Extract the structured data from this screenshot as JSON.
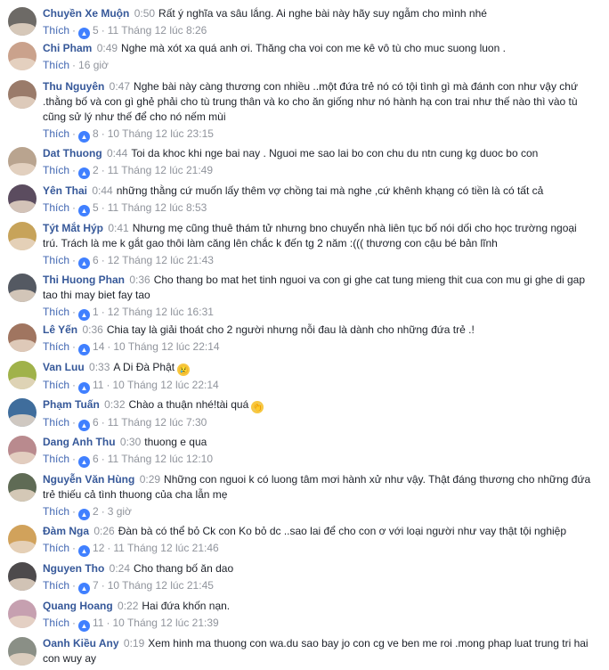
{
  "comments": [
    {
      "author": "Chuyền Xe Muộn",
      "ts": "0:50",
      "text": "Rất ý nghĩa va sâu lắng. Ai nghe bài này hãy suy ngẫm cho mình nhé",
      "like": "Thích",
      "likes": "5",
      "time": "11 Tháng 12 lúc 8:26",
      "avatar": "#6d6a66"
    },
    {
      "author": "Chi Pham",
      "ts": "0:49",
      "text": "Nghe mà xót xa quá anh ơi. Thăng cha voi con me kê vô tù cho muc suong luon .",
      "like": "Thích",
      "likes": "",
      "time": "16 giờ",
      "avatar": "#caa28c"
    },
    {
      "author": "Thu Nguyên",
      "ts": "0:47",
      "text": "Nghe bài này càng thương con nhiều ..một đứa trẻ nó có tội tình gì mà đánh con như vậy chứ .thằng bố và con gì ghẻ phải cho tù trung thân và ko cho ăn giống như nó hành hạ con trai như thế nào thì vào tù cũng sử lý như thế để cho nó nếm mùi",
      "like": "Thích",
      "likes": "8",
      "time": "10 Tháng 12 lúc 23:15",
      "avatar": "#9a7b6a"
    },
    {
      "author": "Dat Thuong",
      "ts": "0:44",
      "text": "Toi da khoc khi nge bai nay . Nguoi me sao lai bo con chu du ntn cung kg duoc bo con",
      "like": "Thích",
      "likes": "2",
      "time": "11 Tháng 12 lúc 21:49",
      "avatar": "#b9a48f"
    },
    {
      "author": "Yên Thai",
      "ts": "0:44",
      "text": "những thằng cứ muốn lấy thêm vợ chồng tai mà nghe ,cứ khênh khạng có tiền là có tất cả",
      "like": "Thích",
      "likes": "5",
      "time": "11 Tháng 12 lúc 8:53",
      "avatar": "#5b4c5f"
    },
    {
      "author": "Týt Mắt Hýp",
      "ts": "0:41",
      "text": "Nhưng mẹ cũng thuê thám tử nhưng bno chuyển nhà liên tục bố nói dối cho học trường ngoại trú. Trách là me k gắt gao thôi làm căng lên chắc k đến tg 2 năm :((( thương con cậu bé bản lĩnh",
      "like": "Thích",
      "likes": "6",
      "time": "12 Tháng 12 lúc 21:43",
      "avatar": "#c7a35a"
    },
    {
      "author": "Thi Huong Phan",
      "ts": "0:36",
      "text": "Cho thang bo mat het tinh nguoi va con gi ghe cat tung mieng thit cua con mu gi ghe di gap tao thi may biet fay tao",
      "like": "Thích",
      "likes": "1",
      "time": "12 Tháng 12 lúc 16:31",
      "avatar": "#545962"
    },
    {
      "author": "Lê Yến",
      "ts": "0:36",
      "text": "Chia tay là giải thoát cho 2 người nhưng nỗi đau là dành cho những đứa trẻ .!",
      "like": "Thích",
      "likes": "14",
      "time": "10 Tháng 12 lúc 22:14",
      "avatar": "#a07560"
    },
    {
      "author": "Van Luu",
      "ts": "0:33",
      "text": "A Di Đà Phật",
      "emoji": "😢",
      "like": "Thích",
      "likes": "11",
      "time": "10 Tháng 12 lúc 22:14",
      "avatar": "#a0b24a"
    },
    {
      "author": "Phạm Tuấn",
      "ts": "0:32",
      "text": "Chào a thuận nhé!tài quá",
      "emoji": "👏",
      "like": "Thích",
      "likes": "6",
      "time": "11 Tháng 12 lúc 7:30",
      "avatar": "#3f6d9c"
    },
    {
      "author": "Dang Anh Thu",
      "ts": "0:30",
      "text": "thuong e qua",
      "like": "Thích",
      "likes": "6",
      "time": "11 Tháng 12 lúc 12:10",
      "avatar": "#b98a8e"
    },
    {
      "author": "Nguyễn Văn Hùng",
      "ts": "0:29",
      "text": "Những con nguoi k có luong tâm mơi hành xử như vậy. Thật đáng thương cho những đứa trẻ thiếu cả tình thuong của cha lẫn mẹ",
      "like": "Thích",
      "likes": "2",
      "time": "3 giờ",
      "avatar": "#5f6b55"
    },
    {
      "author": "Đàm Nga",
      "ts": "0:26",
      "text": "Đàn bà có thể bỏ Ck con Ko bỏ dc ..sao lai để cho con ơ với loại người như vay thật tội nghiệp",
      "like": "Thích",
      "likes": "12",
      "time": "11 Tháng 12 lúc 21:46",
      "avatar": "#d1a25b"
    },
    {
      "author": "Nguyen Tho",
      "ts": "0:24",
      "text": "Cho thang bố ăn dao",
      "like": "Thích",
      "likes": "7",
      "time": "10 Tháng 12 lúc 21:45",
      "avatar": "#4d4a4c"
    },
    {
      "author": "Quang Hoang",
      "ts": "0:22",
      "text": "Hai đứa khốn nạn.",
      "like": "Thích",
      "likes": "11",
      "time": "10 Tháng 12 lúc 21:39",
      "avatar": "#c6a0b0"
    },
    {
      "author": "Oanh Kiều Any",
      "ts": "0:19",
      "text": "Xem hinh ma thuong con wa.du sao bay jo con cg ve ben me roi .mong phap luat trung tri hai con wuy ay",
      "like": "Thích",
      "likes": "",
      "time": "",
      "avatar": "#8a8f86"
    }
  ]
}
